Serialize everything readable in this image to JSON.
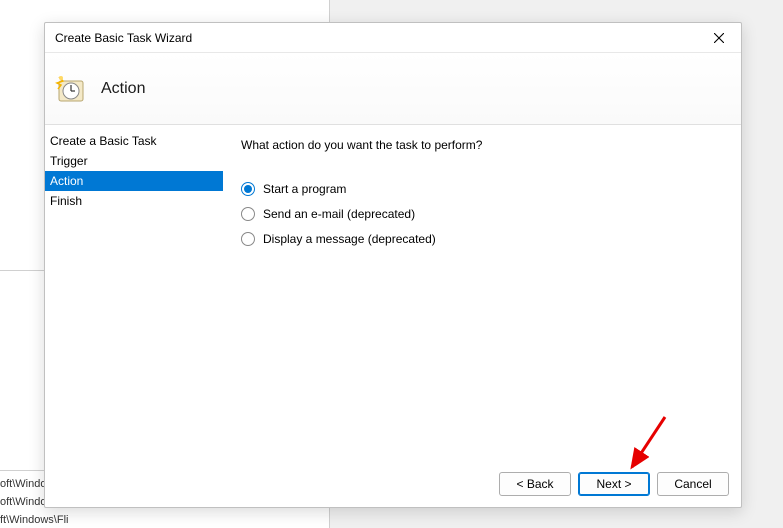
{
  "background": {
    "text1": "oft\\Windo",
    "text2": "oft\\Windows\\U...",
    "text3": "ft\\Windows\\Fli"
  },
  "dialog": {
    "title": "Create Basic Task Wizard",
    "page_title": "Action"
  },
  "sidebar": {
    "items": [
      {
        "label": "Create a Basic Task",
        "selected": false
      },
      {
        "label": "Trigger",
        "selected": false
      },
      {
        "label": "Action",
        "selected": true
      },
      {
        "label": "Finish",
        "selected": false
      }
    ]
  },
  "content": {
    "prompt": "What action do you want the task to perform?",
    "options": [
      {
        "label": "Start a program",
        "checked": true
      },
      {
        "label": "Send an e-mail (deprecated)",
        "checked": false
      },
      {
        "label": "Display a message (deprecated)",
        "checked": false
      }
    ]
  },
  "footer": {
    "back": "< Back",
    "next": "Next >",
    "cancel": "Cancel"
  }
}
